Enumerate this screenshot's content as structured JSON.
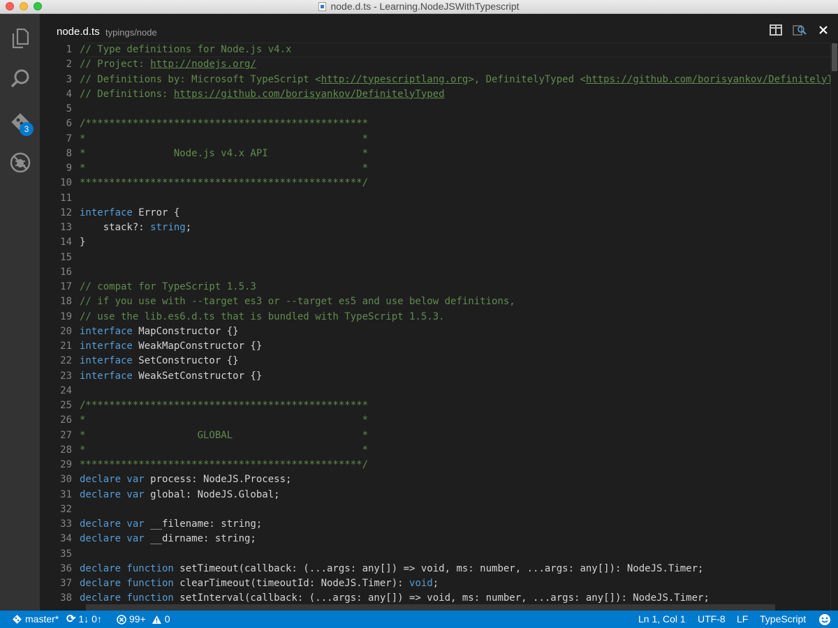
{
  "window": {
    "title": "node.d.ts - Learning.NodeJSWithTypescript"
  },
  "activity_bar": {
    "items": [
      {
        "name": "explorer",
        "icon": "files-icon"
      },
      {
        "name": "search",
        "icon": "search-icon"
      },
      {
        "name": "git",
        "icon": "git-icon",
        "badge": "3"
      },
      {
        "name": "debug",
        "icon": "debug-icon"
      }
    ]
  },
  "tab": {
    "file_name": "node.d.ts",
    "path": "typings/node"
  },
  "code_lines": [
    {
      "n": "1",
      "tokens": [
        {
          "c": "c",
          "t": "// Type definitions for Node.js v4.x"
        }
      ]
    },
    {
      "n": "2",
      "tokens": [
        {
          "c": "c",
          "t": "// Project: "
        },
        {
          "c": "c u",
          "t": "http://nodejs.org/"
        }
      ]
    },
    {
      "n": "3",
      "tokens": [
        {
          "c": "c",
          "t": "// Definitions by: Microsoft TypeScript <"
        },
        {
          "c": "c u",
          "t": "http://typescriptlang.org"
        },
        {
          "c": "c",
          "t": ">, DefinitelyTyped <"
        },
        {
          "c": "c u",
          "t": "https://github.com/borisyankov/DefinitelyTyped"
        }
      ]
    },
    {
      "n": "4",
      "tokens": [
        {
          "c": "c",
          "t": "// Definitions: "
        },
        {
          "c": "c u",
          "t": "https://github.com/borisyankov/DefinitelyTyped"
        }
      ]
    },
    {
      "n": "5",
      "tokens": []
    },
    {
      "n": "6",
      "tokens": [
        {
          "c": "c",
          "t": "/************************************************"
        }
      ]
    },
    {
      "n": "7",
      "tokens": [
        {
          "c": "c",
          "t": "*                                               *"
        }
      ]
    },
    {
      "n": "8",
      "tokens": [
        {
          "c": "c",
          "t": "*               Node.js v4.x API                *"
        }
      ]
    },
    {
      "n": "9",
      "tokens": [
        {
          "c": "c",
          "t": "*                                               *"
        }
      ]
    },
    {
      "n": "10",
      "tokens": [
        {
          "c": "c",
          "t": "************************************************/"
        }
      ]
    },
    {
      "n": "11",
      "tokens": []
    },
    {
      "n": "12",
      "tokens": [
        {
          "c": "k",
          "t": "interface"
        },
        {
          "c": "t",
          "t": " Error {"
        }
      ]
    },
    {
      "n": "13",
      "tokens": [
        {
          "c": "t",
          "t": "    stack?: "
        },
        {
          "c": "k",
          "t": "string"
        },
        {
          "c": "t",
          "t": ";"
        }
      ]
    },
    {
      "n": "14",
      "tokens": [
        {
          "c": "t",
          "t": "}"
        }
      ]
    },
    {
      "n": "15",
      "tokens": []
    },
    {
      "n": "16",
      "tokens": []
    },
    {
      "n": "17",
      "tokens": [
        {
          "c": "c",
          "t": "// compat for TypeScript 1.5.3"
        }
      ]
    },
    {
      "n": "18",
      "tokens": [
        {
          "c": "c",
          "t": "// if you use with --target es3 or --target es5 and use below definitions,"
        }
      ]
    },
    {
      "n": "19",
      "tokens": [
        {
          "c": "c",
          "t": "// use the lib.es6.d.ts that is bundled with TypeScript 1.5.3."
        }
      ]
    },
    {
      "n": "20",
      "tokens": [
        {
          "c": "k",
          "t": "interface"
        },
        {
          "c": "t",
          "t": " MapConstructor {}"
        }
      ]
    },
    {
      "n": "21",
      "tokens": [
        {
          "c": "k",
          "t": "interface"
        },
        {
          "c": "t",
          "t": " WeakMapConstructor {}"
        }
      ]
    },
    {
      "n": "22",
      "tokens": [
        {
          "c": "k",
          "t": "interface"
        },
        {
          "c": "t",
          "t": " SetConstructor {}"
        }
      ]
    },
    {
      "n": "23",
      "tokens": [
        {
          "c": "k",
          "t": "interface"
        },
        {
          "c": "t",
          "t": " WeakSetConstructor {}"
        }
      ]
    },
    {
      "n": "24",
      "tokens": []
    },
    {
      "n": "25",
      "tokens": [
        {
          "c": "c",
          "t": "/************************************************"
        }
      ]
    },
    {
      "n": "26",
      "tokens": [
        {
          "c": "c",
          "t": "*                                               *"
        }
      ]
    },
    {
      "n": "27",
      "tokens": [
        {
          "c": "c",
          "t": "*                   GLOBAL                      *"
        }
      ]
    },
    {
      "n": "28",
      "tokens": [
        {
          "c": "c",
          "t": "*                                               *"
        }
      ]
    },
    {
      "n": "29",
      "tokens": [
        {
          "c": "c",
          "t": "************************************************/"
        }
      ]
    },
    {
      "n": "30",
      "tokens": [
        {
          "c": "k",
          "t": "declare var"
        },
        {
          "c": "t",
          "t": " process: NodeJS.Process;"
        }
      ]
    },
    {
      "n": "31",
      "tokens": [
        {
          "c": "k",
          "t": "declare var"
        },
        {
          "c": "t",
          "t": " global: NodeJS.Global;"
        }
      ]
    },
    {
      "n": "32",
      "tokens": []
    },
    {
      "n": "33",
      "tokens": [
        {
          "c": "k",
          "t": "declare var"
        },
        {
          "c": "t",
          "t": " __filename: string;"
        }
      ]
    },
    {
      "n": "34",
      "tokens": [
        {
          "c": "k",
          "t": "declare var"
        },
        {
          "c": "t",
          "t": " __dirname: string;"
        }
      ]
    },
    {
      "n": "35",
      "tokens": []
    },
    {
      "n": "36",
      "tokens": [
        {
          "c": "k",
          "t": "declare function"
        },
        {
          "c": "t",
          "t": " setTimeout(callback: (...args: any[]) => void, ms: number, ...args: any[]): NodeJS.Timer;"
        }
      ]
    },
    {
      "n": "37",
      "tokens": [
        {
          "c": "k",
          "t": "declare function"
        },
        {
          "c": "t",
          "t": " clearTimeout(timeoutId: NodeJS.Timer): "
        },
        {
          "c": "k",
          "t": "void"
        },
        {
          "c": "t",
          "t": ";"
        }
      ]
    },
    {
      "n": "38",
      "tokens": [
        {
          "c": "k",
          "t": "declare function"
        },
        {
          "c": "t",
          "t": " setInterval(callback: (...args: any[]) => void, ms: number, ...args: any[]): NodeJS.Timer;"
        }
      ]
    }
  ],
  "status_bar": {
    "branch": "master*",
    "sync": "1↓ 0↑",
    "errors": "99+",
    "warnings": "0",
    "cursor": "Ln 1, Col 1",
    "encoding": "UTF-8",
    "eol": "LF",
    "language": "TypeScript"
  },
  "colors": {
    "accent": "#007acc",
    "comment": "#608b4e",
    "keyword": "#569cd6"
  }
}
